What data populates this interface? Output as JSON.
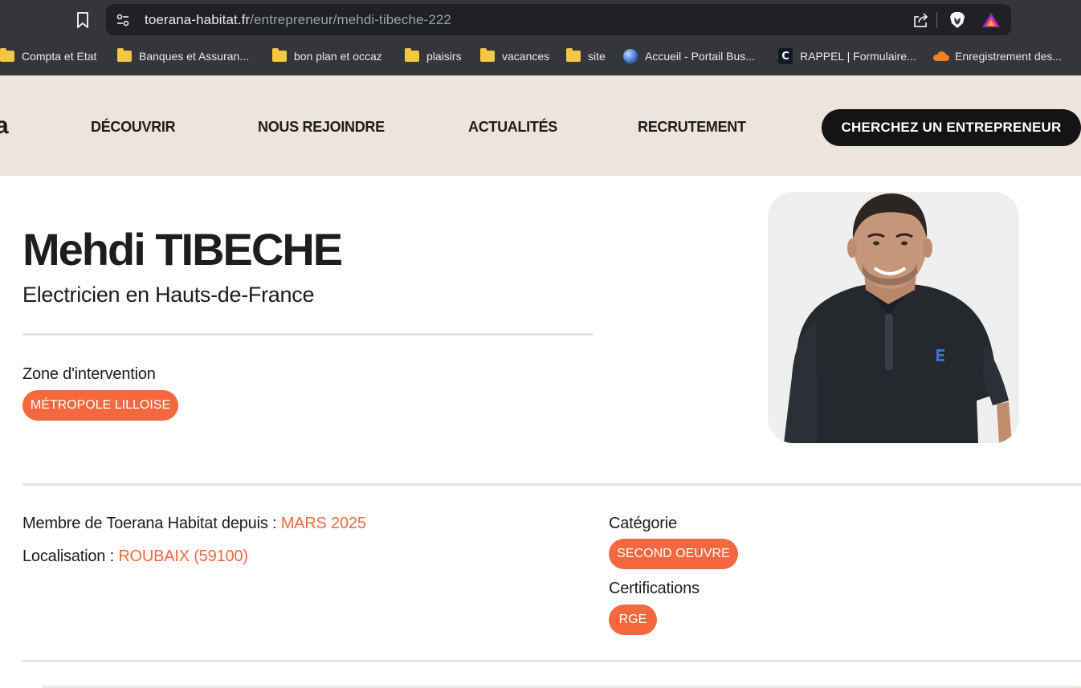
{
  "browser": {
    "url_host": "toerana-habitat.fr",
    "url_path": "/entrepreneur/mehdi-tibeche-222",
    "bookmarks": [
      {
        "label": "Compta et Etat",
        "icon": "folder-icon"
      },
      {
        "label": "Banques et Assuran...",
        "icon": "folder-icon"
      },
      {
        "label": "bon plan et occaz",
        "icon": "folder-icon"
      },
      {
        "label": "plaisirs",
        "icon": "folder-icon"
      },
      {
        "label": "vacances",
        "icon": "folder-icon"
      },
      {
        "label": "site",
        "icon": "folder-icon"
      },
      {
        "label": "Accueil - Portail Bus...",
        "icon": "globe-icon"
      },
      {
        "label": "RAPPEL | Formulaire...",
        "icon": "c-logo-icon"
      },
      {
        "label": "Enregistrement des...",
        "icon": "cloud-icon"
      }
    ]
  },
  "header": {
    "logo_fragment": "a",
    "nav": [
      "DÉCOUVRIR",
      "NOUS REJOINDRE",
      "ACTUALITÉS",
      "RECRUTEMENT"
    ],
    "cta_label": "CHERCHEZ UN ENTREPRENEUR"
  },
  "profile": {
    "name": "Mehdi TIBECHE",
    "subtitle": "Electricien en Hauts-de-France",
    "zone_label": "Zone d'intervention",
    "zone_value": "MÉTROPOLE LILLOISE",
    "member_label": "Membre de Toerana Habitat depuis :",
    "member_value": "MARS 2025",
    "location_label": "Localisation :",
    "location_value": "ROUBAIX (59100)",
    "category_label": "Catégorie",
    "category_value": "SECOND OEUVRE",
    "cert_label": "Certifications",
    "cert_value": "RGE"
  },
  "colors": {
    "accent": "#f4683f",
    "header_bg": "#ede4dc",
    "cta_bg": "#141414",
    "chrome_bg": "#35363a"
  }
}
